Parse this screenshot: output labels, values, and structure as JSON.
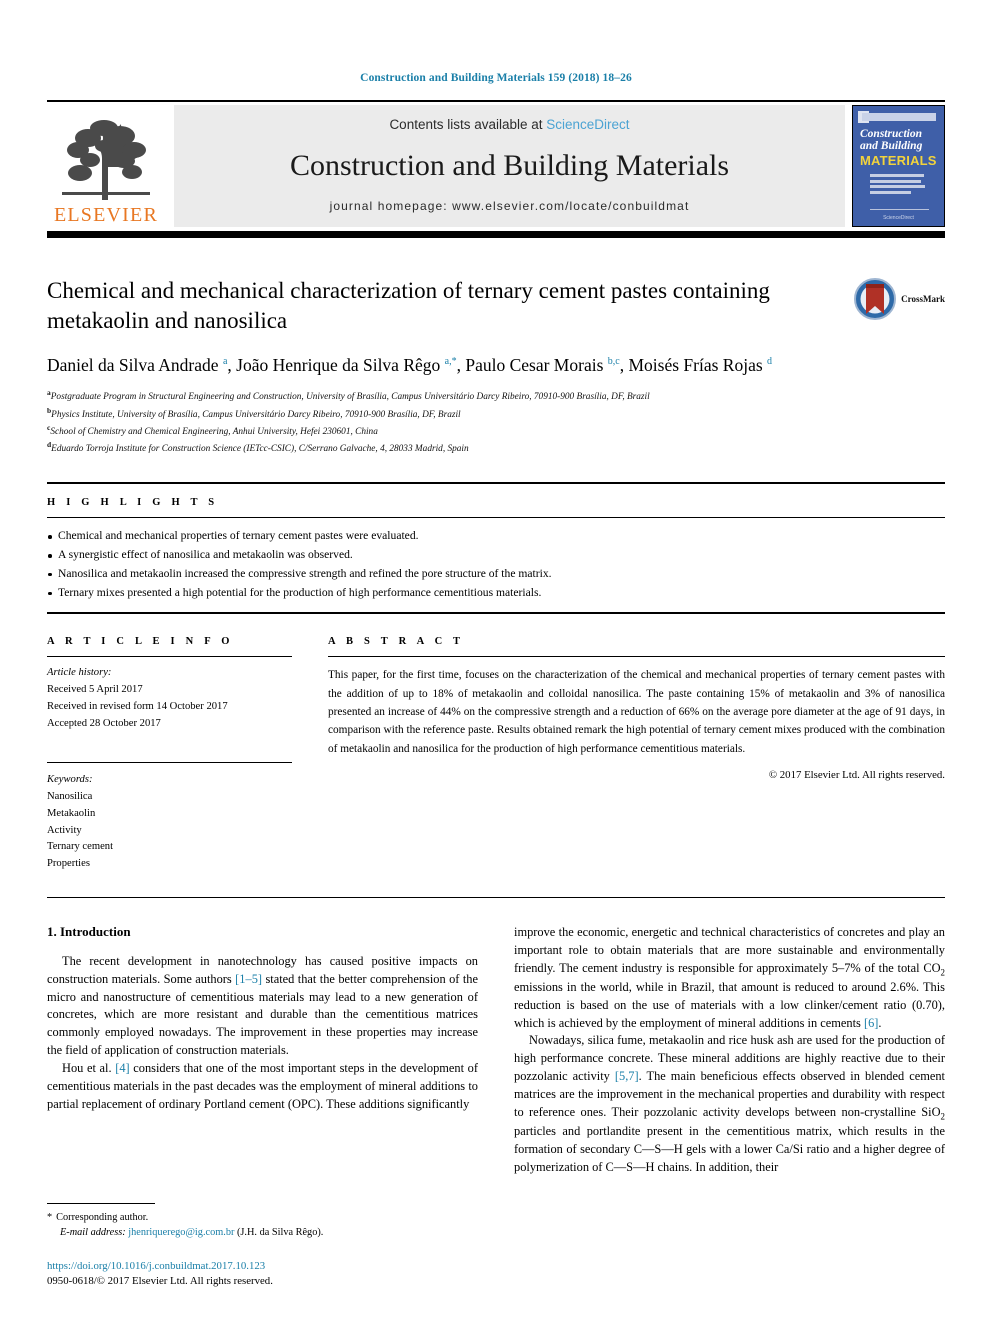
{
  "running_head": "Construction and Building Materials 159 (2018) 18–26",
  "masthead": {
    "publisher_logo_text": "ELSEVIER",
    "contents_prefix": "Contents lists available at ",
    "contents_link": "ScienceDirect",
    "journal_title": "Construction and Building Materials",
    "homepage": "journal homepage: www.elsevier.com/locate/conbuildmat",
    "cover": {
      "line1": "Construction",
      "line2": "and Building",
      "line3": "MATERIALS",
      "blurb": "An international journal of Related Socio Investigation and innovative use of Materials in Construction and Repair",
      "foot": "ScienceDirect"
    }
  },
  "article": {
    "title": "Chemical and mechanical characterization of ternary cement pastes containing metakaolin and nanosilica",
    "crossmark_label": "CrossMark",
    "authors_html": "Daniel da Silva Andrade <sup>a</sup>, João Henrique da Silva Rêgo <sup>a,*</sup>, Paulo Cesar Morais <sup>b,c</sup>, Moisés Frías Rojas <sup>d</sup>",
    "affiliations": [
      {
        "marker": "a",
        "text": "Postgraduate Program in Structural Engineering and Construction, University of Brasília, Campus Universitário Darcy Ribeiro, 70910-900 Brasília, DF, Brazil"
      },
      {
        "marker": "b",
        "text": "Physics Institute, University of Brasília, Campus Universitário Darcy Ribeiro, 70910-900 Brasília, DF, Brazil"
      },
      {
        "marker": "c",
        "text": "School of Chemistry and Chemical Engineering, Anhui University, Hefei 230601, China"
      },
      {
        "marker": "d",
        "text": "Eduardo Torroja Institute for Construction Science (IETcc-CSIC), C/Serrano Galvache, 4, 28033 Madrid, Spain"
      }
    ]
  },
  "highlights": {
    "heading": "H I G H L I G H T S",
    "items": [
      "Chemical and mechanical properties of ternary cement pastes were evaluated.",
      "A synergistic effect of nanosilica and metakaolin was observed.",
      "Nanosilica and metakaolin increased the compressive strength and refined the pore structure of the matrix.",
      "Ternary mixes presented a high potential for the production of high performance cementitious materials."
    ]
  },
  "article_info": {
    "heading": "A R T I C L E    I N F O",
    "history_label": "Article history:",
    "history": [
      "Received 5 April 2017",
      "Received in revised form 14 October 2017",
      "Accepted 28 October 2017"
    ],
    "keywords_label": "Keywords:",
    "keywords": [
      "Nanosilica",
      "Metakaolin",
      "Activity",
      "Ternary cement",
      "Properties"
    ]
  },
  "abstract": {
    "heading": "A B S T R A C T",
    "text": "This paper, for the first time, focuses on the characterization of the chemical and mechanical properties of ternary cement pastes with the addition of up to 18% of metakaolin and colloidal nanosilica. The paste containing 15% of metakaolin and 3% of nanosilica presented an increase of 44% on the compressive strength and a reduction of 66% on the average pore diameter at the age of 91 days, in comparison with the reference paste. Results obtained remark the high potential of ternary cement mixes produced with the combination of metakaolin and nanosilica for the production of high performance cementitious materials.",
    "copyright": "© 2017 Elsevier Ltd. All rights reserved."
  },
  "body": {
    "section_title": "1. Introduction",
    "left_para_1_html": "The recent development in nanotechnology has caused positive impacts on construction materials. Some authors <span class=\"ref\">[1–5]</span> stated that the better comprehension of the micro and nanostructure of cementitious materials may lead to a new generation of concretes, which are more resistant and durable than the cementitious matrices commonly employed nowadays. The improvement in these properties may increase the field of application of construction materials.",
    "left_para_2_html": "Hou et al. <span class=\"ref\">[4]</span> considers that one of the most important steps in the development of cementitious materials in the past decades was the employment of mineral additions to partial replacement of ordinary Portland cement (OPC). These additions significantly",
    "right_para_1_html": "improve the economic, energetic and technical characteristics of concretes and play an important role to obtain materials that are more sustainable and environmentally friendly. The cement industry is responsible for approximately 5–7% of the total CO<span class=\"sub\">2</span> emissions in the world, while in Brazil, that amount is reduced to around 2.6%. This reduction is based on the use of materials with a low clinker/cement ratio (0.70), which is achieved by the employment of mineral additions in cements <span class=\"ref\">[6]</span>.",
    "right_para_2_html": "Nowadays, silica fume, metakaolin and rice husk ash are used for the production of high performance concrete. These mineral additions are highly reactive due to their pozzolanic activity <span class=\"ref\">[5,7]</span>. The main beneficious effects observed in blended cement matrices are the improvement in the mechanical properties and durability with respect to reference ones. Their pozzolanic activity develops between non-crystalline SiO<span class=\"sub\">2</span> particles and portlandite present in the cementitious matrix, which results in the formation of secondary C—S—H gels with a lower Ca/Si ratio and a higher degree of polymerization of C—S—H chains. In addition, their"
  },
  "footnote": {
    "corresponding_marker": "*",
    "corresponding_text": "Corresponding author.",
    "email_label": "E-mail address:",
    "email": "jhenriquerego@ig.com.br",
    "email_owner": "(J.H. da Silva Rêgo).",
    "doi": "https://doi.org/10.1016/j.conbuildmat.2017.10.123",
    "issn_line": "0950-0618/© 2017 Elsevier Ltd. All rights reserved."
  },
  "colors": {
    "link": "#1a7fa8",
    "sciencedirect": "#4ba3d3",
    "elsevier_orange": "#E87722",
    "cover_blue": "#3f5fa8",
    "crossmark_blue": "#2e6aa8",
    "crossmark_red": "#b03126"
  }
}
